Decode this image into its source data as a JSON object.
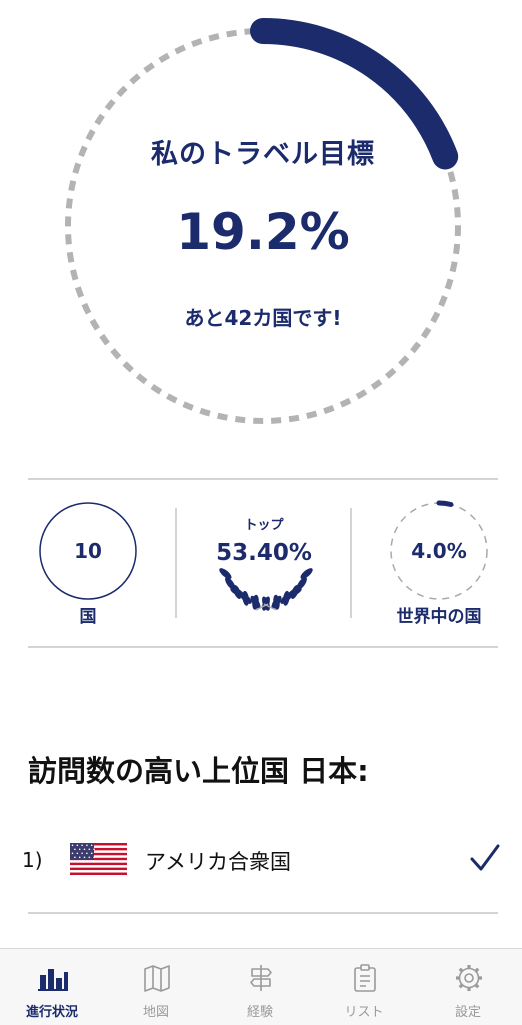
{
  "goal": {
    "title": "私のトラベル目標",
    "percent_text": "19.2%",
    "progress_fraction": 0.192,
    "remaining_text": "あと42カ国です!"
  },
  "stats": {
    "countries": {
      "value": "10",
      "label": "国"
    },
    "ranking": {
      "caption": "トップ",
      "value": "53.40%"
    },
    "world": {
      "value": "4.0%",
      "label": "世界中の国",
      "progress_fraction": 0.04
    }
  },
  "top_countries": {
    "title": "訪問数の高い上位国 日本:",
    "items": [
      {
        "rank": "1)",
        "name": "アメリカ合衆国",
        "flag_icon": "us-flag-icon",
        "checked": true
      }
    ]
  },
  "tabbar": {
    "tabs": [
      {
        "label": "進行状況",
        "icon": "bar-chart-icon",
        "active": true
      },
      {
        "label": "地図",
        "icon": "map-icon",
        "active": false
      },
      {
        "label": "経験",
        "icon": "signpost-icon",
        "active": false
      },
      {
        "label": "リスト",
        "icon": "clipboard-icon",
        "active": false
      },
      {
        "label": "設定",
        "icon": "gear-icon",
        "active": false
      }
    ]
  },
  "colors": {
    "accent": "#1b2b6b",
    "ring_track": "#b3b3b3",
    "divider": "#d4d4d4"
  }
}
